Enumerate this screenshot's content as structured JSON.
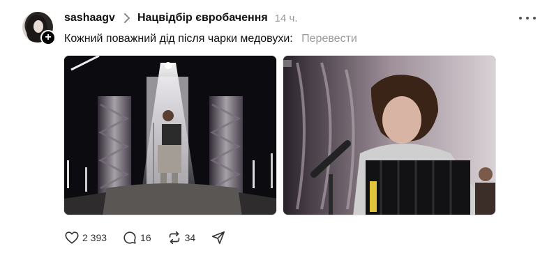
{
  "post": {
    "username": "sashaagv",
    "community": "Нацвідбір євробачення",
    "time": "14 ч.",
    "text": "Кожний поважний дід після чарки медовухи:",
    "translate_label": "Перевести",
    "follow_symbol": "+"
  },
  "media": [
    {
      "name": "stage-performance-image",
      "description": ""
    },
    {
      "name": "accordion-closeup-image",
      "description": ""
    }
  ],
  "actions": {
    "likes": "2 393",
    "replies": "16",
    "reposts": "34"
  },
  "icons": {
    "like": "heart-icon",
    "reply": "comment-icon",
    "repost": "repost-icon",
    "share": "share-icon",
    "more": "more-icon",
    "breadcrumb": "chevron-right-icon"
  },
  "colors": {
    "text": "#101010",
    "muted": "#999999"
  }
}
